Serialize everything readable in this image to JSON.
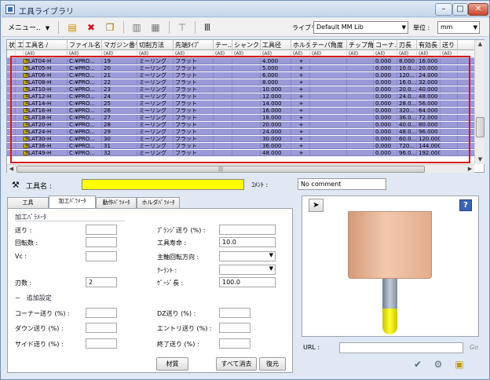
{
  "window": {
    "title": "工具ライブラリ",
    "min": "–",
    "max": "□",
    "close": "✕"
  },
  "toolbar": {
    "menu_label": "メニュー..",
    "library_label": "ライブラリ :",
    "library_value": "Default MM Lib",
    "unit_label": "単位 :",
    "unit_value": "mm"
  },
  "grid": {
    "columns": [
      "状",
      "工",
      "工具名 /",
      "ファイル名",
      "マガジン番号",
      "切削方法",
      "先端ﾀｲﾌﾟ",
      "テー..",
      "シャンク",
      "工具径",
      "ホルダ",
      "テーパ角度",
      "チップ角",
      "コーナ..",
      "刃長",
      "有効長",
      "送り"
    ],
    "filter": "(All)",
    "rows": [
      {
        "name": "FLAT04-H",
        "file": "C:¥PRO...",
        "mag": "19",
        "cut": "ミーリング",
        "tip": "フラット",
        "dia": "4.000",
        "holder": "+",
        "corner": "0.000",
        "flute": "8.000",
        "eff": "16.000"
      },
      {
        "name": "FLAT05-H",
        "file": "C:¥PRO...",
        "mag": "20",
        "cut": "ミーリング",
        "tip": "フラット",
        "dia": "5.000",
        "holder": "+",
        "corner": "0.000",
        "flute": "10.0...",
        "eff": "20.000"
      },
      {
        "name": "FLAT06-H",
        "file": "C:¥PRO...",
        "mag": "21",
        "cut": "ミーリング",
        "tip": "フラット",
        "dia": "6.000",
        "holder": "+",
        "corner": "0.000",
        "flute": "120...",
        "eff": "24.000"
      },
      {
        "name": "FLAT08-H",
        "file": "C:¥PRO...",
        "mag": "22",
        "cut": "ミーリング",
        "tip": "フラット",
        "dia": "8.000",
        "holder": "+",
        "corner": "0.000",
        "flute": "16.0...",
        "eff": "32.000"
      },
      {
        "name": "FLAT10-H",
        "file": "C:¥PRO...",
        "mag": "23",
        "cut": "ミーリング",
        "tip": "フラット",
        "dia": "10.000",
        "holder": "+",
        "corner": "0.000",
        "flute": "20.0...",
        "eff": "40.000"
      },
      {
        "name": "FLAT12-H",
        "file": "C:¥PRO...",
        "mag": "24",
        "cut": "ミーリング",
        "tip": "フラット",
        "dia": "12.000",
        "holder": "+",
        "corner": "0.000",
        "flute": "24.0...",
        "eff": "48.000"
      },
      {
        "name": "FLAT14-H",
        "file": "C:¥PRO...",
        "mag": "25",
        "cut": "ミーリング",
        "tip": "フラット",
        "dia": "14.000",
        "holder": "+",
        "corner": "0.000",
        "flute": "28.0...",
        "eff": "56.000"
      },
      {
        "name": "FLAT16-H",
        "file": "C:¥PRO...",
        "mag": "26",
        "cut": "ミーリング",
        "tip": "フラット",
        "dia": "16.000",
        "holder": "+",
        "corner": "0.000",
        "flute": "320...",
        "eff": "64.000"
      },
      {
        "name": "FLAT18-H",
        "file": "C:¥PRO...",
        "mag": "27",
        "cut": "ミーリング",
        "tip": "フラット",
        "dia": "18.000",
        "holder": "+",
        "corner": "0.000",
        "flute": "36.0...",
        "eff": "72.000"
      },
      {
        "name": "FLAT20-H",
        "file": "C:¥PRO...",
        "mag": "28",
        "cut": "ミーリング",
        "tip": "フラット",
        "dia": "20.000",
        "holder": "+",
        "corner": "0.000",
        "flute": "40.0...",
        "eff": "80.000"
      },
      {
        "name": "FLAT24-H",
        "file": "C:¥PRO...",
        "mag": "29",
        "cut": "ミーリング",
        "tip": "フラット",
        "dia": "24.000",
        "holder": "+",
        "corner": "0.000",
        "flute": "48.0...",
        "eff": "96.000"
      },
      {
        "name": "FLAT30-H",
        "file": "C:¥PRO...",
        "mag": "30",
        "cut": "ミーリング",
        "tip": "フラット",
        "dia": "30.000",
        "holder": "+",
        "corner": "0.000",
        "flute": "60.0...",
        "eff": "120.000"
      },
      {
        "name": "FLAT36-H",
        "file": "C:¥PRO...",
        "mag": "31",
        "cut": "ミーリング",
        "tip": "フラット",
        "dia": "36.000",
        "holder": "+",
        "corner": "0.000",
        "flute": "720...",
        "eff": "144.000"
      },
      {
        "name": "FLAT49-H",
        "file": "C:¥PRO...",
        "mag": "32",
        "cut": "ミーリング",
        "tip": "フラット",
        "dia": "48.000",
        "holder": "+",
        "corner": "0.000",
        "flute": "96.0...",
        "eff": "192.000"
      }
    ]
  },
  "detail": {
    "tool_name_label": "工具名 :",
    "tool_name_value": "",
    "comment_label": "ｺﾒﾝﾄ :",
    "comment_value": "No comment",
    "tabs": [
      "工具",
      "加工ﾊﾟﾗﾒｰﾀ",
      "動作ﾊﾟﾗﾒｰﾀ",
      "ホルダﾊﾟﾗﾒｰﾀ"
    ],
    "section_title": "加工ﾊﾟﾗﾒｰﾀ",
    "feed_label": "送り :",
    "spindle_label": "回転数 :",
    "vc_label": "Vc :",
    "plunge_label": "ﾌﾟﾗﾝｼﾞ送り (%) :",
    "life_label": "工具寿命 :",
    "life_value": "10.0",
    "spindle_dir_label": "主軸回転方向 :",
    "coolant_label": "ｸｰﾗﾝﾄ :",
    "flutes_label": "刃数 :",
    "flutes_value": "2",
    "gauge_label": "ｹﾞｰｼﾞ長 :",
    "gauge_value": "100.0",
    "extra_title": "−　追加設定",
    "corner_feed_label": "コーナー送り (%) :",
    "down_feed_label": "ダウン送り (%) :",
    "side_feed_label": "サイド送り (%) :",
    "dz_feed_label": "DZ送り (%) :",
    "entry_feed_label": "エントリ送り (%) :",
    "end_feed_label": "終了送り (%) :",
    "material_button": "材質",
    "clear_button": "すべて消去",
    "restore_button": "復元"
  },
  "preview": {
    "url_label": "URL :",
    "url_value": "",
    "go_label": "Go",
    "help": "?"
  },
  "colors": {
    "row_selected": "#9a9ad8",
    "highlight_border": "#d7181e",
    "tool_name_bg": "#ffff00"
  }
}
